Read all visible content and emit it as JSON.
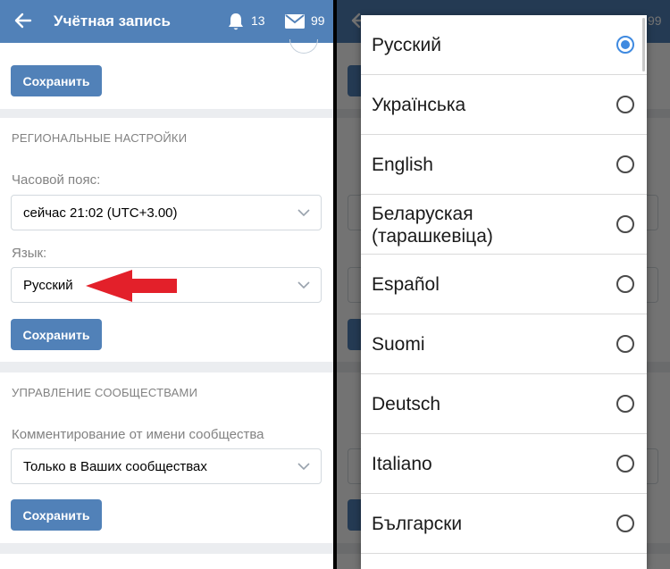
{
  "header": {
    "title": "Учётная запись",
    "notifications_count": "13",
    "messages_count": "99"
  },
  "account_card": {
    "save_label": "Сохранить"
  },
  "regional": {
    "section_title": "РЕГИОНАЛЬНЫЕ НАСТРОЙКИ",
    "timezone_label": "Часовой пояс:",
    "timezone_value": "сейчас 21:02 (UTC+3.00)",
    "language_label": "Язык:",
    "language_value": "Русский",
    "save_label": "Сохранить"
  },
  "communities": {
    "section_title": "УПРАВЛЕНИЕ СООБЩЕСТВАМИ",
    "comment_label": "Комментирование от имени сообщества",
    "comment_value": "Только в Ваших сообществах",
    "save_label": "Сохранить"
  },
  "language_dialog": {
    "selected": "Русский",
    "options": [
      {
        "label": "Русский",
        "selected": true
      },
      {
        "label": "Українська",
        "selected": false
      },
      {
        "label": "English",
        "selected": false
      },
      {
        "label": "Беларуская (тарашкевіца)",
        "selected": false
      },
      {
        "label": "Español",
        "selected": false
      },
      {
        "label": "Suomi",
        "selected": false
      },
      {
        "label": "Deutsch",
        "selected": false
      },
      {
        "label": "Italiano",
        "selected": false
      },
      {
        "label": "Български",
        "selected": false
      }
    ]
  },
  "colors": {
    "brand_blue": "#5181b8",
    "radio_selected": "#3f8ae0",
    "arrow_red": "#e3202a"
  },
  "icons": {
    "back": "arrow-left-icon",
    "notifications": "bell-icon",
    "messages": "envelope-icon",
    "dropdown": "chevron-down-icon",
    "pointer": "red-arrow-annotation"
  }
}
